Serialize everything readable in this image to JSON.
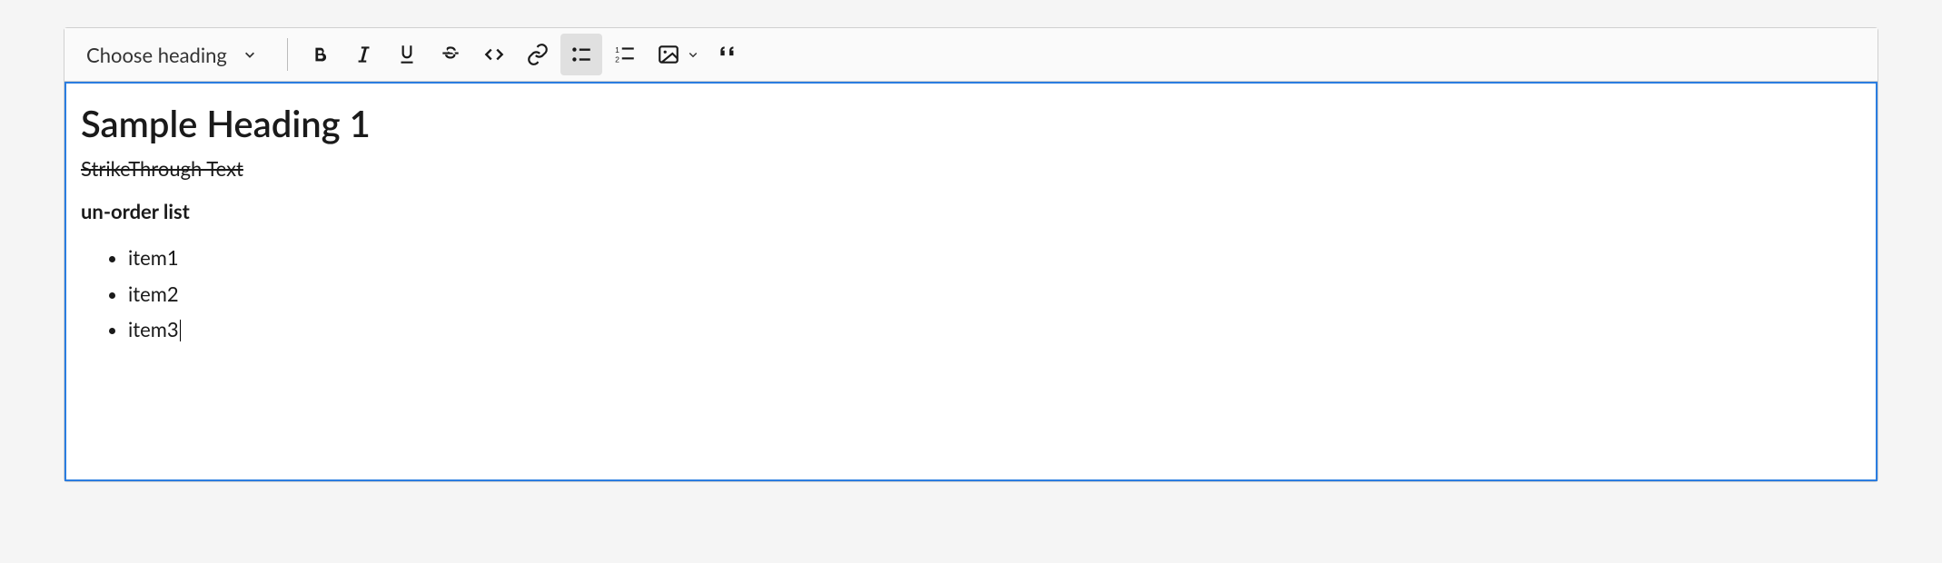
{
  "toolbar": {
    "heading_selector": "Choose heading",
    "buttons": {
      "bold": "bold",
      "italic": "italic",
      "underline": "underline",
      "strikethrough": "strikethrough",
      "code": "code",
      "link": "link",
      "bullet_list": "bullet-list",
      "numbered_list": "numbered-list",
      "image": "image",
      "blockquote": "blockquote"
    },
    "active_button": "bullet-list"
  },
  "content": {
    "heading": "Sample Heading 1",
    "strike_text": "StrikeThrough Text",
    "bold_text": "un-order list",
    "list_items": [
      "item1",
      "item2",
      "item3"
    ]
  }
}
